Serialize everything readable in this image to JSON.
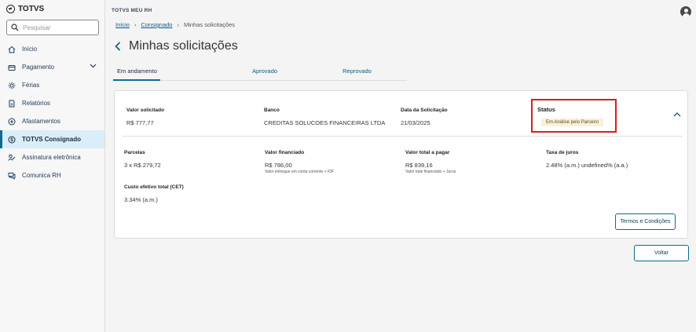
{
  "app": {
    "brand": "TOTVS",
    "title": "TOTVS MEU RH"
  },
  "search": {
    "placeholder": "Pesquisar"
  },
  "sidebar": {
    "items": [
      {
        "label": "Início"
      },
      {
        "label": "Pagamento"
      },
      {
        "label": "Férias"
      },
      {
        "label": "Relatórios"
      },
      {
        "label": "Afastamentos"
      },
      {
        "label": "TOTVS Consignado"
      },
      {
        "label": "Assinatura eletrônica"
      },
      {
        "label": "Comunica RH"
      }
    ]
  },
  "breadcrumb": {
    "home": "Início",
    "section": "Consignado",
    "current": "Minhas solicitações"
  },
  "page": {
    "title": "Minhas solicitações"
  },
  "tabs": [
    {
      "label": "Em andamento"
    },
    {
      "label": "Aprovado"
    },
    {
      "label": "Reprovado"
    }
  ],
  "request": {
    "valor_solicitado": {
      "label": "Valor solicitado",
      "value": "R$ 777,77"
    },
    "banco": {
      "label": "Banco",
      "value": "CREDITAS SOLUCOES FINANCEIRAS LTDA"
    },
    "data": {
      "label": "Data da Solicitação",
      "value": "21/03/2025"
    },
    "status": {
      "label": "Status",
      "value": "Em Análise pelo Parceiro"
    },
    "parcelas": {
      "label": "Parcelas",
      "value": "3 x R$ 279,72"
    },
    "valor_financiado": {
      "label": "Valor financiado",
      "value": "R$ 786,00",
      "note": "Valor entregue em conta corrente + IOF"
    },
    "valor_total": {
      "label": "Valor total a pagar",
      "value": "R$ 839,16",
      "note": "Valor total financiado + Juros"
    },
    "taxa_juros": {
      "label": "Taxa de juros",
      "value": "2.48% (a.m.) undefined% (a.a.)"
    },
    "cet": {
      "label": "Custo efetivo total (CET)",
      "value": "3.34% (a.m.)"
    },
    "terms_button": "Termos e Condições"
  },
  "back_button": "Voltar",
  "colors": {
    "accent": "#0c6c94",
    "highlight": "#e11b1b",
    "badge_bg": "#fbf0d8"
  }
}
